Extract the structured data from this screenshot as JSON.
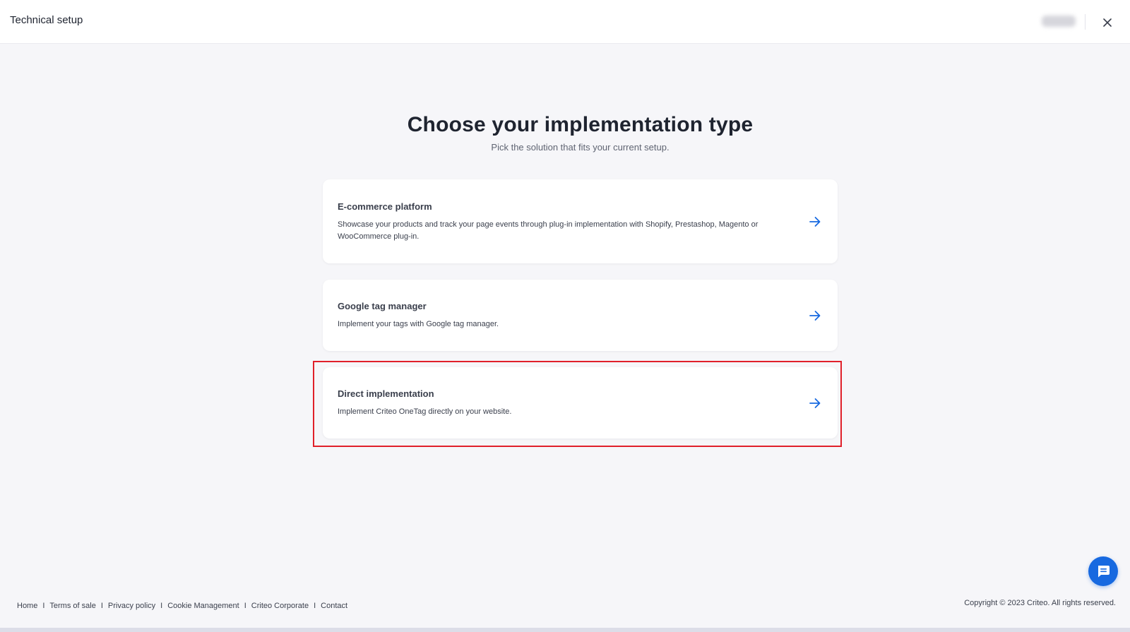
{
  "header": {
    "title": "Technical setup",
    "close_icon": "close-icon"
  },
  "main": {
    "title": "Choose your implementation type",
    "subtitle": "Pick the solution that fits your current setup."
  },
  "options": [
    {
      "title": "E-commerce platform",
      "description": "Showcase your products and track your page events through plug-in implementation with Shopify, Prestashop, Magento or WooCommerce plug-in.",
      "icon": "arrow-right-icon"
    },
    {
      "title": "Google tag manager",
      "description": "Implement your tags with Google tag manager.",
      "icon": "arrow-right-icon"
    },
    {
      "title": "Direct implementation",
      "description": "Implement Criteo OneTag directly on your website.",
      "icon": "arrow-right-icon"
    }
  ],
  "footer": {
    "links": [
      "Home",
      "Terms of sale",
      "Privacy policy",
      "Cookie Management",
      "Criteo Corporate",
      "Contact"
    ],
    "separator": "I",
    "copyright": "Copyright © 2023 Criteo. All rights reserved."
  },
  "chat": {
    "icon": "chat-icon"
  },
  "colors": {
    "accent": "#1769e0",
    "highlight": "#e0202a",
    "background": "#f6f6f9"
  }
}
